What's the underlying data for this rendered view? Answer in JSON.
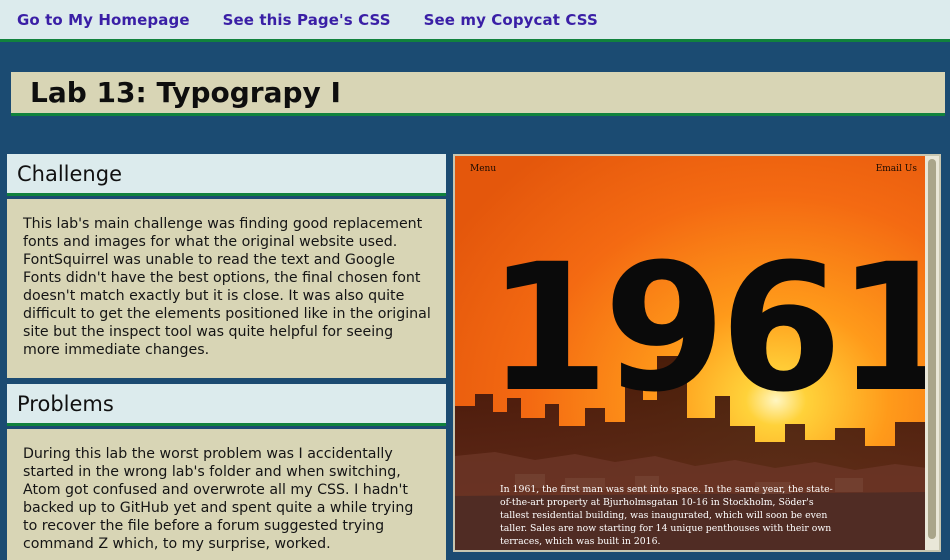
{
  "nav": {
    "links": [
      {
        "label": "Go to My Homepage"
      },
      {
        "label": "See this Page's CSS"
      },
      {
        "label": "See my Copycat CSS"
      }
    ]
  },
  "page": {
    "title": "Lab 13: Typograpy I"
  },
  "sections": {
    "challenge": {
      "heading": "Challenge",
      "body": "This lab's main challenge was finding good replacement fonts and images for what the original website used. FontSquirrel was unable to read the text and Google Fonts didn't have the best options, the final chosen font doesn't match exactly but it is close. It was also quite difficult to get the elements positioned like in the original site but the inspect tool was quite helpful for seeing more immediate changes."
    },
    "problems": {
      "heading": "Problems",
      "body": "During this lab the worst problem was I accidentally started in the wrong lab's folder and when switching, Atom got confused and overwrote all my CSS. I hadn't backed up to GitHub yet and spent quite a while trying to recover the file before a forum suggested trying command Z which, to my surprise, worked."
    }
  },
  "preview": {
    "menu_label": "Menu",
    "email_label": "Email Us",
    "year": "1961",
    "paragraph": "In 1961, the first man was sent into space. In the same year, the state-of-the-art property at Bjurholmsgatan 10-16 in Stockholm, Söder's tallest residential building, was inaugurated, which will soon be even taller. Sales are now starting for 14 unique penthouses with their own terraces, which was built in 2016."
  },
  "colors": {
    "background": "#1b4b72",
    "nav_background": "#dcebed",
    "accent_green": "#11823d",
    "panel_tan": "#d8d5b5",
    "link_purple": "#3a1fa6"
  }
}
